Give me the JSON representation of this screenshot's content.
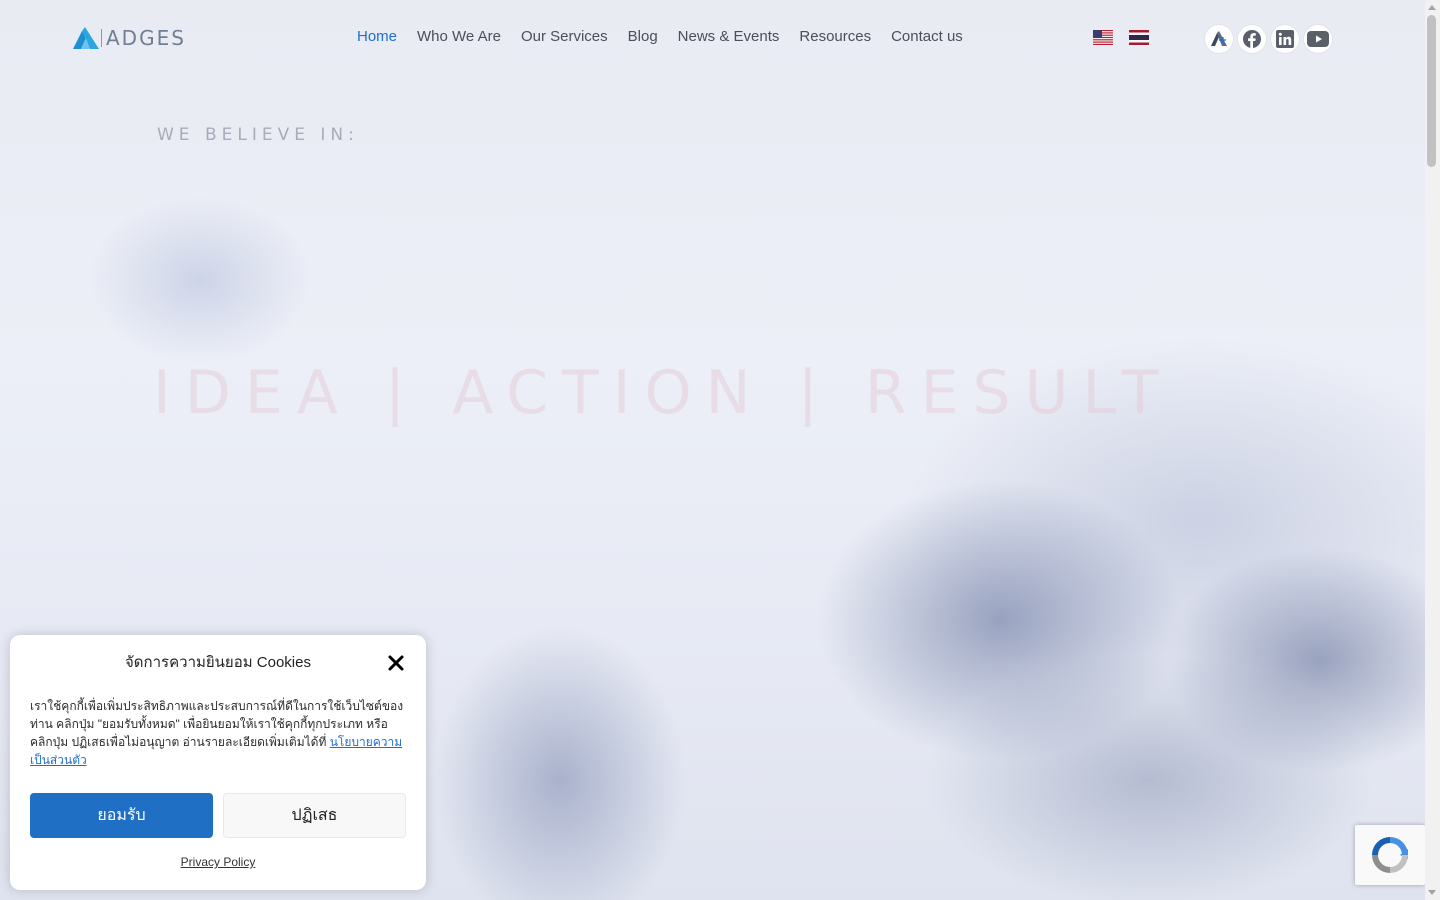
{
  "brand": {
    "logo_text": "ADGES",
    "colors": {
      "primary": "#1f6fd0",
      "logo_blue": "#2aa7e0",
      "logo_gray": "#6f7f94"
    }
  },
  "nav": {
    "items": [
      {
        "label": "Home",
        "active": true
      },
      {
        "label": "Who We Are",
        "active": false
      },
      {
        "label": "Our Services",
        "active": false
      },
      {
        "label": "Blog",
        "active": false
      },
      {
        "label": "News & Events",
        "active": false
      },
      {
        "label": "Resources",
        "active": false
      },
      {
        "label": "Contact us",
        "active": false
      }
    ]
  },
  "languages": [
    {
      "icon": "us-flag-icon"
    },
    {
      "icon": "thai-flag-icon"
    }
  ],
  "socials": [
    {
      "icon": "adges-icon"
    },
    {
      "icon": "facebook-icon"
    },
    {
      "icon": "linkedin-icon"
    },
    {
      "icon": "youtube-icon"
    }
  ],
  "hero": {
    "kicker": "WE BELIEVE IN:",
    "tagline": "IDEA | ACTION | RESULT"
  },
  "cookie": {
    "title": "จัดการความยินยอม Cookies",
    "body": "เราใช้คุกกี้เพื่อเพิ่มประสิทธิภาพและประสบการณ์ที่ดีในการใช้เว็บไซต์ของท่าน คลิกปุ่ม \"ยอมรับทั้งหมด\" เพื่อยินยอมให้เราใช้คุกกี้ทุกประเภท หรือคลิกปุ่ม ปฏิเสธเพื่อไม่อนุญาต อ่านรายละเอียดเพิ่มเติมได้ที่",
    "link": "นโยบายความเป็นส่วนตัว",
    "accept_label": "ยอมรับ",
    "deny_label": "ปฏิเสธ",
    "privacy_label": "Privacy Policy"
  }
}
